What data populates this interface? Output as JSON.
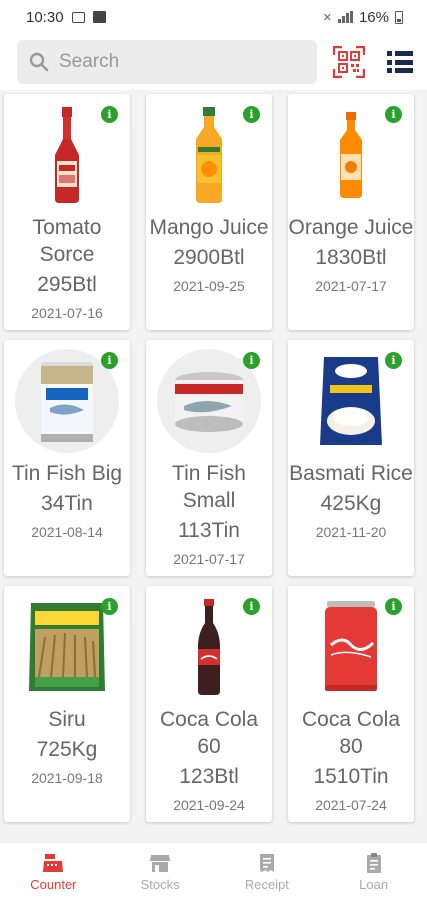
{
  "status": {
    "time": "10:30",
    "battery": "16%",
    "icons": [
      "message-icon",
      "image-icon",
      "mute-icon",
      "signal-icon",
      "battery-icon"
    ]
  },
  "search": {
    "placeholder": "Search",
    "value": ""
  },
  "toolbar": {
    "icons": [
      "qr-scan-icon",
      "list-view-icon"
    ],
    "accent": "#e53935",
    "menu_color": "#1b2b4a"
  },
  "products": [
    {
      "name": "Tomato Sorce",
      "qty": "295Btl",
      "date": "2021-07-16",
      "icon": "tomato-sauce-bottle"
    },
    {
      "name": "Mango Juice",
      "qty": "2900Btl",
      "date": "2021-09-25",
      "icon": "mango-juice-bottle"
    },
    {
      "name": "Orange Juice",
      "qty": "1830Btl",
      "date": "2021-07-17",
      "icon": "orange-juice-bottle"
    },
    {
      "name": "Tin Fish Big",
      "qty": "34Tin",
      "date": "2021-08-14",
      "icon": "tin-fish-big-can"
    },
    {
      "name": "Tin Fish Small",
      "qty": "113Tin",
      "date": "2021-07-17",
      "icon": "tin-fish-small-can"
    },
    {
      "name": "Basmati Rice",
      "qty": "425Kg",
      "date": "2021-11-20",
      "icon": "basmati-rice-bag"
    },
    {
      "name": "Siru",
      "qty": "725Kg",
      "date": "2021-09-18",
      "icon": "siru-rice-bag"
    },
    {
      "name": "Coca Cola 60",
      "qty": "123Btl",
      "date": "2021-09-24",
      "icon": "coca-cola-bottle"
    },
    {
      "name": "Coca Cola 80",
      "qty": "1510Tin",
      "date": "2021-07-24",
      "icon": "coca-cola-can"
    }
  ],
  "nav": [
    {
      "label": "Counter",
      "icon": "cash-register-icon",
      "active": true
    },
    {
      "label": "Stocks",
      "icon": "store-icon",
      "active": false
    },
    {
      "label": "Receipt",
      "icon": "receipt-icon",
      "active": false
    },
    {
      "label": "Loan",
      "icon": "clipboard-icon",
      "active": false
    }
  ],
  "colors": {
    "info_badge": "#2ca02c",
    "active_nav": "#e53935",
    "inactive_nav": "#aaaaaa"
  }
}
